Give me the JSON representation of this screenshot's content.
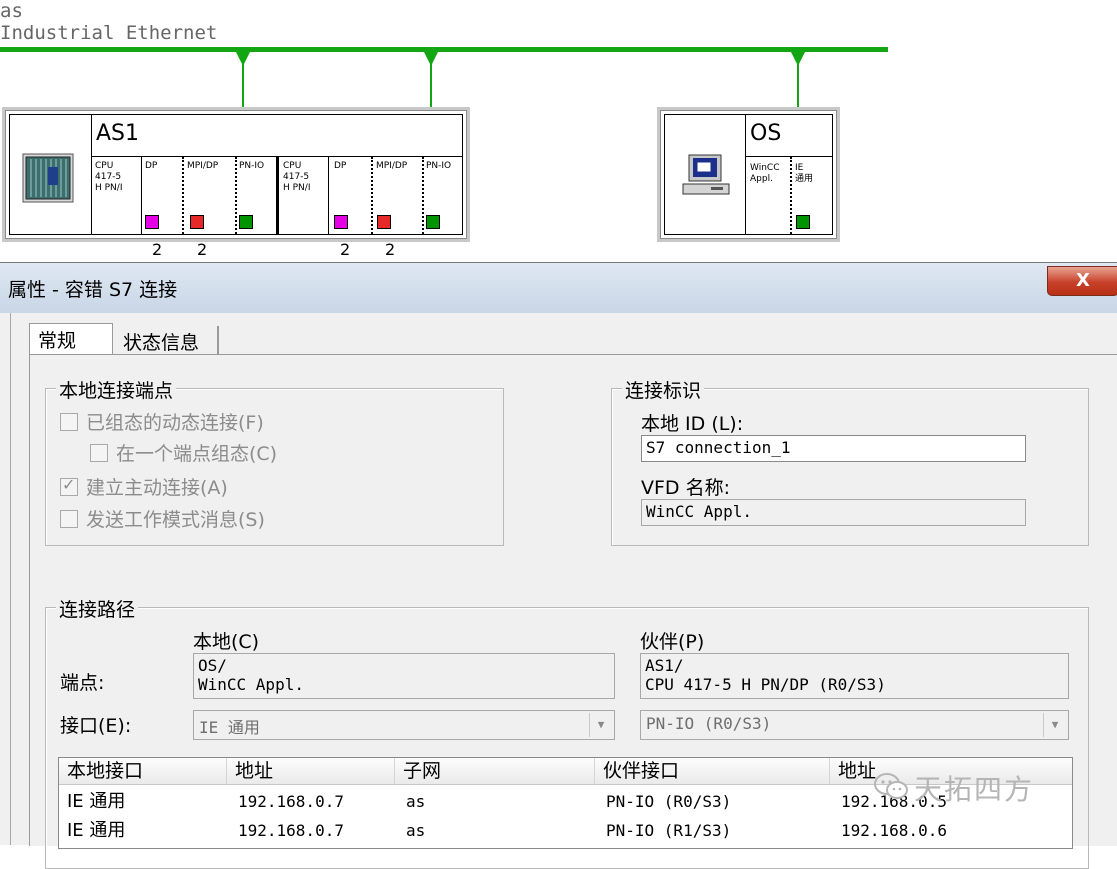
{
  "network": {
    "name": "as",
    "type": "Industrial Ethernet"
  },
  "stations": {
    "as1": {
      "title": "AS1",
      "modules": [
        {
          "label": "CPU\n417-5\nH PN/I"
        },
        {
          "label": "DP"
        },
        {
          "label": "MPI/DP"
        },
        {
          "label": "PN-IO"
        },
        {
          "label": "CPU\n417-5\nH PN/I"
        },
        {
          "label": "DP"
        },
        {
          "label": "MPI/DP"
        },
        {
          "label": "PN-IO"
        }
      ],
      "counts": [
        "2",
        "2",
        "2",
        "2"
      ]
    },
    "os": {
      "title": "OS",
      "modules": [
        {
          "label": "WinCC\nAppl."
        },
        {
          "label": "IE\n通用"
        }
      ]
    }
  },
  "dialog": {
    "title": "属性 - 容错 S7 连接",
    "close_label": "X",
    "tabs": [
      {
        "label": "常规",
        "active": true
      },
      {
        "label": "状态信息",
        "active": false
      }
    ],
    "local_endpoint": {
      "title": "本地连接端点",
      "options": [
        {
          "label": "已组态的动态连接(F)",
          "checked": false
        },
        {
          "label": "在一个端点组态(C)",
          "checked": false
        },
        {
          "label": "建立主动连接(A)",
          "checked": true
        },
        {
          "label": "发送工作模式消息(S)",
          "checked": false
        }
      ]
    },
    "conn_id": {
      "title": "连接标识",
      "local_id_label": "本地 ID (L):",
      "local_id_value": "S7 connection_1",
      "vfd_label": "VFD 名称:",
      "vfd_value": "WinCC Appl."
    },
    "path": {
      "title": "连接路径",
      "local_header": "本地(C)",
      "partner_header": "伙伴(P)",
      "endpoint_label": "端点:",
      "local_endpoint_lines": [
        "OS/",
        "WinCC Appl."
      ],
      "partner_endpoint_lines": [
        "AS1/",
        "CPU 417-5 H PN/DP (R0/S3)"
      ],
      "interface_label": "接口(E):",
      "local_interface": "IE 通用",
      "partner_interface": "PN-IO (R0/S3)"
    },
    "table": {
      "columns": [
        "本地接口",
        "地址",
        "子网",
        "伙伴接口",
        "地址"
      ],
      "rows": [
        [
          "IE 通用",
          "192.168.0.7",
          "as",
          "PN-IO (R0/S3)",
          "192.168.0.5"
        ],
        [
          "IE 通用",
          "192.168.0.7",
          "as",
          "PN-IO (R1/S3)",
          "192.168.0.6"
        ]
      ]
    }
  },
  "watermark": "天拓四方",
  "colors": {
    "bus_green": "#13a613",
    "dp_magenta": "#e600e6",
    "mpi_red": "#e62828",
    "pn_green": "#009400",
    "close_red": "#c7412a"
  }
}
